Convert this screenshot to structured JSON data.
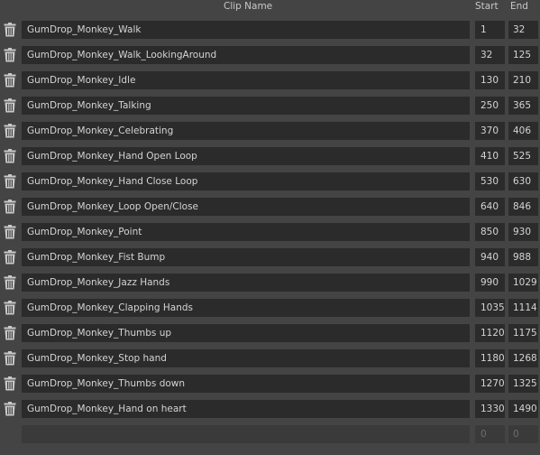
{
  "header": {
    "clip_name": "Clip Name",
    "start": "Start",
    "end": "End"
  },
  "icons": {
    "delete": "trash-icon"
  },
  "colors": {
    "background": "#444444",
    "field": "#2b2b2b",
    "empty_field": "#3a3a3a",
    "text": "#d4d4d4",
    "empty_text": "#6e6e6e"
  },
  "clips": [
    {
      "name": "GumDrop_Monkey_Walk",
      "start": "1",
      "end": "32"
    },
    {
      "name": "GumDrop_Monkey_Walk_LookingAround",
      "start": "32",
      "end": "125"
    },
    {
      "name": "GumDrop_Monkey_Idle",
      "start": "130",
      "end": "210"
    },
    {
      "name": "GumDrop_Monkey_Talking",
      "start": "250",
      "end": "365"
    },
    {
      "name": "GumDrop_Monkey_Celebrating",
      "start": "370",
      "end": "406"
    },
    {
      "name": "GumDrop_Monkey_Hand Open Loop",
      "start": "410",
      "end": "525"
    },
    {
      "name": "GumDrop_Monkey_Hand Close Loop",
      "start": "530",
      "end": "630"
    },
    {
      "name": "GumDrop_Monkey_Loop Open/Close",
      "start": "640",
      "end": "846"
    },
    {
      "name": "GumDrop_Monkey_Point",
      "start": "850",
      "end": "930"
    },
    {
      "name": "GumDrop_Monkey_Fist Bump",
      "start": "940",
      "end": "988"
    },
    {
      "name": "GumDrop_Monkey_Jazz Hands",
      "start": "990",
      "end": "1029"
    },
    {
      "name": "GumDrop_Monkey_Clapping Hands",
      "start": "1035",
      "end": "1114"
    },
    {
      "name": "GumDrop_Monkey_Thumbs up",
      "start": "1120",
      "end": "1175"
    },
    {
      "name": "GumDrop_Monkey_Stop hand",
      "start": "1180",
      "end": "1268"
    },
    {
      "name": "GumDrop_Monkey_Thumbs down",
      "start": "1270",
      "end": "1325"
    },
    {
      "name": "GumDrop_Monkey_Hand on heart",
      "start": "1330",
      "end": "1490"
    }
  ],
  "new_clip": {
    "name": "",
    "start": "0",
    "end": "0"
  }
}
